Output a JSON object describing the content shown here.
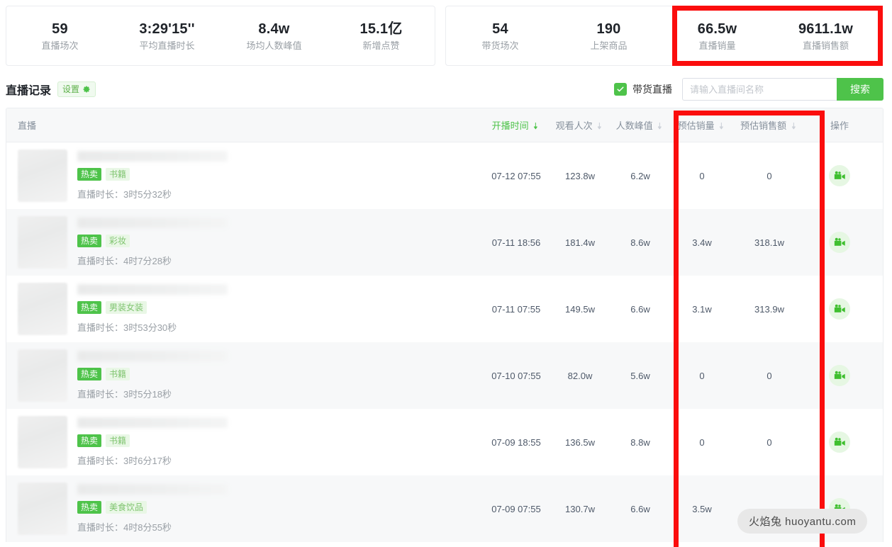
{
  "summary": {
    "card_left": [
      {
        "value": "59",
        "label": "直播场次"
      },
      {
        "value": "3:29'15''",
        "label": "平均直播时长"
      },
      {
        "value": "8.4w",
        "label": "场均人数峰值"
      },
      {
        "value": "15.1亿",
        "label": "新增点赞"
      }
    ],
    "card_right": [
      {
        "value": "54",
        "label": "带货场次"
      },
      {
        "value": "190",
        "label": "上架商品"
      },
      {
        "value": "66.5w",
        "label": "直播销量"
      },
      {
        "value": "9611.1w",
        "label": "直播销售额"
      }
    ]
  },
  "toolbar": {
    "title": "直播记录",
    "settings_label": "设置",
    "checkbox_label": "带货直播",
    "checkbox_checked": true,
    "search_placeholder": "请输入直播间名称",
    "search_value": "",
    "search_button": "搜索"
  },
  "table": {
    "headers": {
      "live": "直播",
      "start_time": "开播时间",
      "views": "观看人次",
      "peak": "人数峰值",
      "est_sales": "预估销量",
      "est_gmv": "预估销售额",
      "action": "操作"
    },
    "sorted_column": "开播时间",
    "rows": [
      {
        "hot_badge": "热卖",
        "category": "书籍",
        "duration": "直播时长：3时5分32秒",
        "start_time": "07-12 07:55",
        "views": "123.8w",
        "peak": "6.2w",
        "est_sales": "0",
        "est_gmv": "0"
      },
      {
        "hot_badge": "热卖",
        "category": "彩妆",
        "duration": "直播时长：4时7分28秒",
        "start_time": "07-11 18:56",
        "views": "181.4w",
        "peak": "8.6w",
        "est_sales": "3.4w",
        "est_gmv": "318.1w"
      },
      {
        "hot_badge": "热卖",
        "category": "男装女装",
        "duration": "直播时长：3时53分30秒",
        "start_time": "07-11 07:55",
        "views": "149.5w",
        "peak": "6.6w",
        "est_sales": "3.1w",
        "est_gmv": "313.9w"
      },
      {
        "hot_badge": "热卖",
        "category": "书籍",
        "duration": "直播时长：3时5分18秒",
        "start_time": "07-10 07:55",
        "views": "82.0w",
        "peak": "5.6w",
        "est_sales": "0",
        "est_gmv": "0"
      },
      {
        "hot_badge": "热卖",
        "category": "书籍",
        "duration": "直播时长：3时6分17秒",
        "start_time": "07-09 18:55",
        "views": "136.5w",
        "peak": "8.8w",
        "est_sales": "0",
        "est_gmv": "0"
      },
      {
        "hot_badge": "热卖",
        "category": "美食饮品",
        "duration": "直播时长：4时8分55秒",
        "start_time": "07-09 07:55",
        "views": "130.7w",
        "peak": "6.6w",
        "est_sales": "3.5w",
        "est_gmv": ""
      }
    ]
  },
  "watermark": "火焰兔 huoyantu.com",
  "colors": {
    "brand_green": "#4ec34a",
    "annotation_red": "#fb0d0d",
    "row_alt": "#f7f8f9",
    "muted_text": "#9aa0a6"
  }
}
